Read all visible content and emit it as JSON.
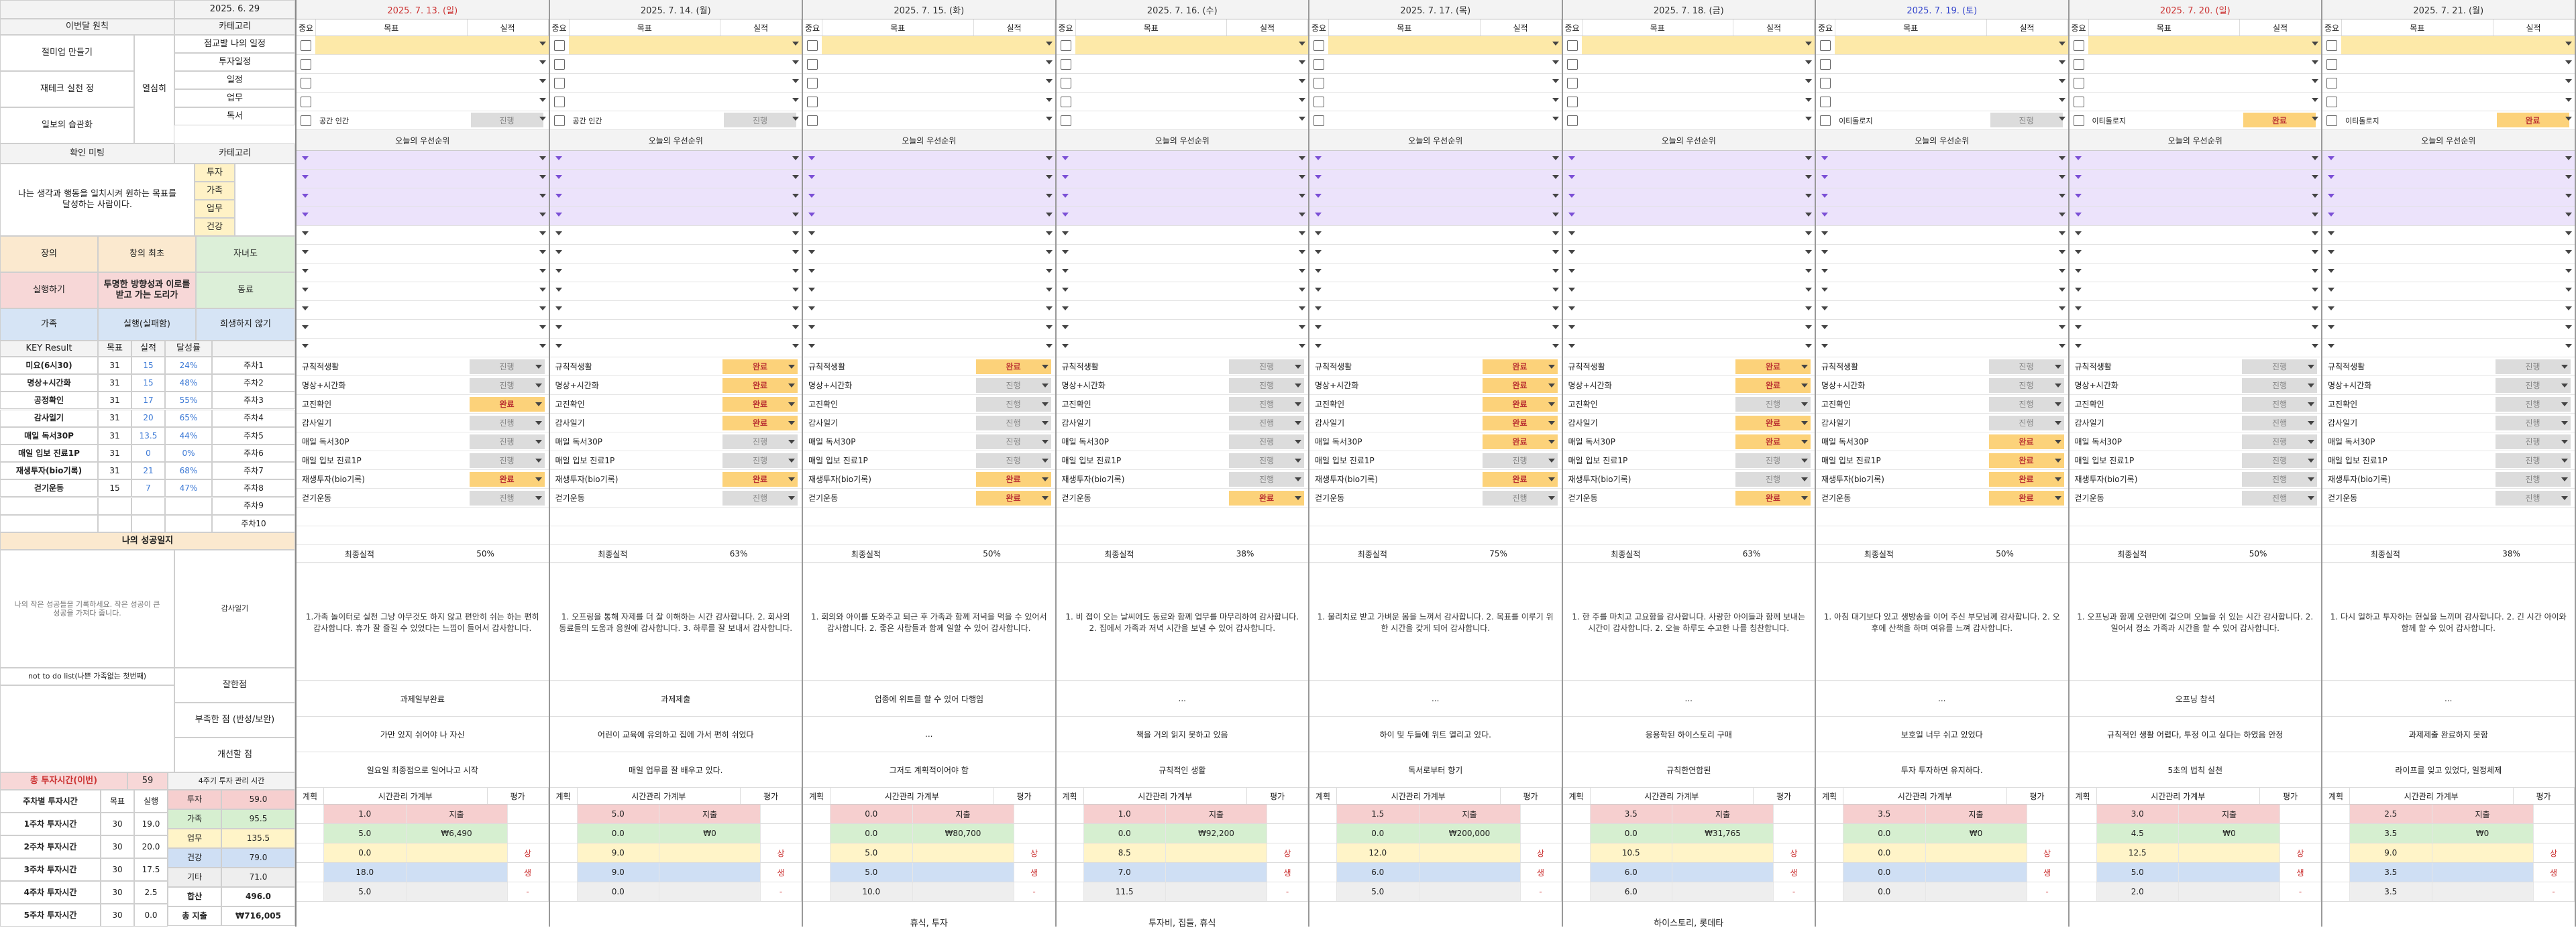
{
  "left": {
    "date": "2025. 6. 29",
    "header_a": "이번달 원칙",
    "header_b": "카테고리",
    "top_labels": [
      "절미업 만들기",
      "재테크 실천 정",
      "일보의 습관화"
    ],
    "cat_top": [
      "점교발 나의 일정",
      "투자일정",
      "일정",
      "업무",
      "독서"
    ],
    "cat_side": "열심히",
    "mission_title": "확인 미팅",
    "mission_cat": "카테고리",
    "mission_text": "나는 생각과 행동을 일치시켜 원하는 목표를 달성하는 사람이다.",
    "areas": [
      "투자",
      "가족",
      "업무",
      "건강"
    ],
    "grid": [
      [
        "장의",
        "창의 최초",
        "자녀도"
      ],
      [
        "실행하기",
        "투명한 방향성과 이로를 받고 가는 도리가",
        "동료"
      ],
      [
        "가족",
        "실행(실패함)",
        "희생하지 않기"
      ]
    ],
    "kr_head": [
      "KEY Result",
      "목표",
      "실적",
      "달성률"
    ],
    "kr": [
      {
        "name": "미요(6시30)",
        "target": "31",
        "actual": "15",
        "rate": "24%",
        "week": "주차1"
      },
      {
        "name": "명상+시간화",
        "target": "31",
        "actual": "15",
        "rate": "48%",
        "week": "주차2"
      },
      {
        "name": "공정확인",
        "target": "31",
        "actual": "17",
        "rate": "55%",
        "week": "주차3"
      },
      {
        "name": "감사일기",
        "target": "31",
        "actual": "20",
        "rate": "65%",
        "week": "주차4"
      },
      {
        "name": "매일 독서30P",
        "target": "31",
        "actual": "13.5",
        "rate": "44%",
        "week": "주차5"
      },
      {
        "name": "매일 입보 진료1P",
        "target": "31",
        "actual": "0",
        "rate": "0%",
        "week": "주차6"
      },
      {
        "name": "재생투자(bio기록)",
        "target": "31",
        "actual": "21",
        "rate": "68%",
        "week": "주차7"
      },
      {
        "name": "걷기운동",
        "target": "15",
        "actual": "7",
        "rate": "47%",
        "week": "주차8"
      },
      {
        "name": "",
        "target": "",
        "actual": "",
        "rate": "",
        "week": "주차9"
      },
      {
        "name": "",
        "target": "",
        "actual": "",
        "rate": "",
        "week": "주차10"
      }
    ],
    "diary_title": "나의 성공일지",
    "diary_sub": "감사일기",
    "diary_note": "나의 작은 성공들을 기록하세요. 작은 성공이 큰 성공을 가져다 줍니다.",
    "notdo": "not to do list(나쁜 가족없는 첫번째)",
    "side_labels": [
      "잘한점",
      "부족한 점 (반성/보완)",
      "개선할 점"
    ],
    "time_title": "총 투자시간(이번)",
    "time_head": [
      "",
      "목표",
      "실적"
    ],
    "time_rows": [
      {
        "label": "주차별 투자시간",
        "a": "목표",
        "b": "실행"
      },
      {
        "label": "1주차 투자시간",
        "a": "30",
        "b": "19.0"
      },
      {
        "label": "2주차 투자시간",
        "a": "30",
        "b": "20.0"
      },
      {
        "label": "3주차 투자시간",
        "a": "30",
        "b": "17.5"
      },
      {
        "label": "4주차 투자시간",
        "a": "30",
        "b": "2.5"
      },
      {
        "label": "5주차 투자시간",
        "a": "30",
        "b": "0.0"
      }
    ],
    "time_cat_head": "4주기 투자 관리 시간",
    "time_cats": [
      {
        "k": "투자",
        "v": "59.0"
      },
      {
        "k": "가족",
        "v": "95.5"
      },
      {
        "k": "업무",
        "v": "135.5"
      },
      {
        "k": "건강",
        "v": "79.0"
      },
      {
        "k": "기타",
        "v": "71.0"
      },
      {
        "k": "합산",
        "v": "496.0"
      },
      {
        "k": "총 지출",
        "v": "₩716,005"
      }
    ],
    "total_label": "59"
  },
  "col_head": [
    "중요",
    "목표",
    "실적"
  ],
  "section_title": "오늘의 우선순위",
  "summary_label": "최종실적",
  "plan_head": [
    "계획",
    "시간관리 가계부",
    "평가"
  ],
  "plan_cats": [
    "투자",
    "가족",
    "업무",
    "건강",
    "기타"
  ],
  "days": [
    {
      "date": "2025. 7. 13. (일)",
      "color": "#cc3333",
      "top_note": "공간 인간",
      "top_status": "진행",
      "kr": [
        "진행",
        "진행",
        "완료",
        "진행",
        "진행",
        "진행",
        "완료",
        "진행"
      ],
      "summary": "50%",
      "diary": "1.가족 놀이터로 실천 그냥 아무것도 하지 않고 편안히 쉬는 하는 편히 감사합니다. 휴가 잘 즐길 수 있었다는 느낌이 들어서 감사합니다.",
      "good": "과제일부완료",
      "bad": "가만 있지 쉬어야 나 자신",
      "improve": "일요일 최종점으로 일어나고 시작",
      "plan": [
        "1.0",
        "5.0",
        "0.0",
        "18.0",
        "5.0"
      ],
      "money": [
        "지출",
        "₩6,490",
        "상",
        "생",
        "-"
      ],
      "foot": ""
    },
    {
      "date": "2025. 7. 14. (월)",
      "color": "#333333",
      "top_note": "공간 인간",
      "top_status": "진행",
      "kr": [
        "완료",
        "완료",
        "완료",
        "완료",
        "진행",
        "진행",
        "완료",
        "진행"
      ],
      "summary": "63%",
      "diary": "1. 오프링을 통해 자제를 더 잘 이해하는 시간 감사합니다. 2. 회사의 동료들의 도움과 응원에 감사합니다. 3. 하루를 잘 보내서 감사합니다.",
      "good": "과제제출",
      "bad": "어린이 교육에 유의하고 집에 가서 편히 쉬었다",
      "improve": "매일 업무를 잘 배우고 있다.",
      "plan": [
        "5.0",
        "0.0",
        "9.0",
        "9.0",
        "0.0"
      ],
      "money": [
        "지출",
        "₩0",
        "상",
        "생",
        "-"
      ],
      "foot": ""
    },
    {
      "date": "2025. 7. 15. (화)",
      "color": "#333333",
      "top_note": "",
      "top_status": "",
      "kr": [
        "완료",
        "진행",
        "진행",
        "진행",
        "진행",
        "진행",
        "완료",
        "완료"
      ],
      "summary": "50%",
      "diary": "1. 회의와 아이를 도와주고 퇴근 후 가족과 함께 저녁을 먹을 수 있어서 감사합니다. 2. 좋은 사람들과 함께 일할 수 있어 감사합니다.",
      "good": "업종에 위트를 할 수 있어 다행임",
      "bad": "...",
      "improve": "그저도 계획적이어야 함",
      "plan": [
        "0.0",
        "0.0",
        "5.0",
        "5.0",
        "10.0"
      ],
      "money": [
        "지출",
        "₩80,700",
        "상",
        "생",
        "-"
      ],
      "foot": "휴식, 투자"
    },
    {
      "date": "2025. 7. 16. (수)",
      "color": "#333333",
      "top_note": "",
      "top_status": "",
      "kr": [
        "진행",
        "진행",
        "진행",
        "진행",
        "진행",
        "진행",
        "진행",
        "완료"
      ],
      "summary": "38%",
      "diary": "1. 비 접이 오는 날씨에도 동료와 함께 업무를 마무리하여 감사합니다. 2. 집에서 가족과 저녁 시간을 보낼 수 있어 감사합니다.",
      "good": "...",
      "bad": "책을 거의 읽지 못하고 있음",
      "improve": "규칙적인 생활",
      "plan": [
        "1.0",
        "0.0",
        "8.5",
        "7.0",
        "11.5"
      ],
      "money": [
        "지출",
        "₩92,200",
        "상",
        "생",
        "-"
      ],
      "foot": "투자비, 집들, 휴식"
    },
    {
      "date": "2025. 7. 17. (목)",
      "color": "#333333",
      "top_note": "",
      "top_status": "",
      "kr": [
        "완료",
        "완료",
        "완료",
        "완료",
        "완료",
        "진행",
        "완료",
        "진행"
      ],
      "summary": "75%",
      "diary": "1. 물리치료 받고 가벼운 몸을 느껴서 감사합니다. 2. 목표를 이루기 위한 시간을 갖게 되어 감사합니다.",
      "good": "...",
      "bad": "하이 및 두들에 위트 열리고 있다.",
      "improve": "독서로부터 향기",
      "plan": [
        "1.5",
        "0.0",
        "12.0",
        "6.0",
        "5.0"
      ],
      "money": [
        "지출",
        "₩200,000",
        "상",
        "생",
        "-"
      ],
      "foot": ""
    },
    {
      "date": "2025. 7. 18. (금)",
      "color": "#333333",
      "top_note": "",
      "top_status": "",
      "kr": [
        "완료",
        "완료",
        "진행",
        "완료",
        "완료",
        "진행",
        "진행",
        "완료"
      ],
      "summary": "63%",
      "diary": "1. 한 주를 마치고 고요함을 감사합니다. 사랑한 아이들과 함께 보내는 시간이 감사합니다. 2. 오늘 하루도 수고한 나를 칭찬합니다.",
      "good": "...",
      "bad": "응용학된 하이스토리 구매",
      "improve": "규칙한연합된",
      "plan": [
        "3.5",
        "0.0",
        "10.5",
        "6.0",
        "6.0"
      ],
      "money": [
        "지출",
        "₩31,765",
        "상",
        "생",
        "-"
      ],
      "foot": "하이스토리, 롯데타"
    },
    {
      "date": "2025. 7. 19. (토)",
      "color": "#3344cc",
      "top_note": "이티돌로지",
      "top_status": "진행",
      "kr": [
        "진행",
        "진행",
        "진행",
        "진행",
        "완료",
        "완료",
        "완료",
        "완료"
      ],
      "summary": "50%",
      "diary": "1. 아침 대기보다 있고 생방송을 이어 주신 부모님께 감사합니다. 2. 오후에 산책을 하며 여유를 느껴 감사합니다.",
      "good": "...",
      "bad": "보호일 너무 쉬고 있었다",
      "improve": "투자 투자하면 유지하다.",
      "plan": [
        "3.5",
        "0.0",
        "0.0",
        "0.0",
        "0.0"
      ],
      "money": [
        "지출",
        "₩0",
        "상",
        "생",
        "-"
      ],
      "foot": ""
    },
    {
      "date": "2025. 7. 20. (일)",
      "color": "#cc3333",
      "top_note": "이티돌로지",
      "top_status": "완료",
      "kr": [
        "진행",
        "진행",
        "진행",
        "진행",
        "진행",
        "진행",
        "진행",
        "진행"
      ],
      "summary": "50%",
      "diary": "1. 오프닝과 함께 오랜만에 걸으며 오늘을 쉬 있는 시간 감사합니다. 2. 일어서 정소 가족과 시간을 할 수 있어 감사합니다.",
      "good": "오프닝 참석",
      "bad": "규칙적인 생활 어렵다, 투정 이고 싶다는 하였음 안정",
      "improve": "5초의 법칙 실천",
      "plan": [
        "3.0",
        "4.5",
        "12.5",
        "5.0",
        "2.0"
      ],
      "money": [
        "지출",
        "₩0",
        "상",
        "생",
        "-"
      ],
      "foot": ""
    },
    {
      "date": "2025. 7. 21. (월)",
      "color": "#333333",
      "top_note": "이티돌로지",
      "top_status": "완료",
      "kr": [
        "진행",
        "진행",
        "진행",
        "진행",
        "진행",
        "진행",
        "진행",
        "진행"
      ],
      "summary": "38%",
      "diary": "1. 다시 일하고 투자하는 현실을 느끼며 감사합니다. 2. 긴 시간 아이와 함께 할 수 있어 감사합니다.",
      "good": "...",
      "bad": "과제제출 완료하지 못함",
      "improve": "라이프를 잊고 있었다, 일정체제",
      "plan": [
        "2.5",
        "3.5",
        "9.0",
        "3.5",
        "3.5"
      ],
      "money": [
        "지출",
        "₩0",
        "상",
        "생",
        "-"
      ],
      "foot": ""
    }
  ],
  "kr_names": [
    "규칙적생활",
    "명상+시간화",
    "고진확인",
    "감사일기",
    "매일 독서30P",
    "매일 입보 진료1P",
    "재생투자(bio기록)",
    "걷기운동"
  ]
}
